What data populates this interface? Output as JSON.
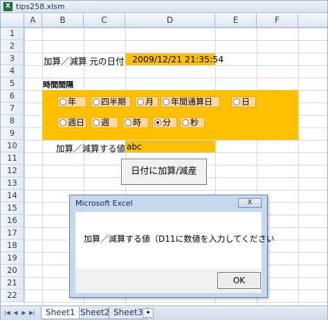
{
  "window": {
    "title": "tips258.xlsm",
    "app_icon": "excel-icon"
  },
  "grid": {
    "columns": [
      "A",
      "B",
      "C",
      "D",
      "E",
      "F"
    ],
    "rows": [
      "1",
      "2",
      "3",
      "4",
      "5",
      "6",
      "7",
      "8",
      "9",
      "10",
      "11",
      "12",
      "13",
      "14",
      "15",
      "16",
      "17",
      "18",
      "19",
      "20",
      "21",
      "22"
    ]
  },
  "cells": {
    "b3_label": "加算／減算 元の日付",
    "d3_value": "2009/12/21 21:35:54",
    "b5_label": "時間間隔",
    "b11_label": "加算／減算する値",
    "d11_value": "abc"
  },
  "options": {
    "row1": [
      {
        "label": "年",
        "selected": false
      },
      {
        "label": "四半期",
        "selected": false
      },
      {
        "label": "月",
        "selected": false
      },
      {
        "label": "年間通算日",
        "selected": false
      },
      {
        "label": "日",
        "selected": false
      }
    ],
    "row2": [
      {
        "label": "週日",
        "selected": false
      },
      {
        "label": "週",
        "selected": false
      },
      {
        "label": "時",
        "selected": false
      },
      {
        "label": "分",
        "selected": true
      },
      {
        "label": "秒",
        "selected": false
      }
    ]
  },
  "sheet_button": {
    "label": "日付に加算/減産"
  },
  "tabs": {
    "items": [
      "Sheet1",
      "Sheet2",
      "Sheet3"
    ],
    "active": "Sheet1"
  },
  "dialog": {
    "title": "Microsoft Excel",
    "close_label": "X",
    "message": "加算／減算する値（D11に数値を入力してください",
    "ok_label": "OK"
  },
  "colors": {
    "accent_orange": "#ffc000",
    "option_fill": "#ffd79a",
    "dialog_frame": "#c6d8ee"
  }
}
